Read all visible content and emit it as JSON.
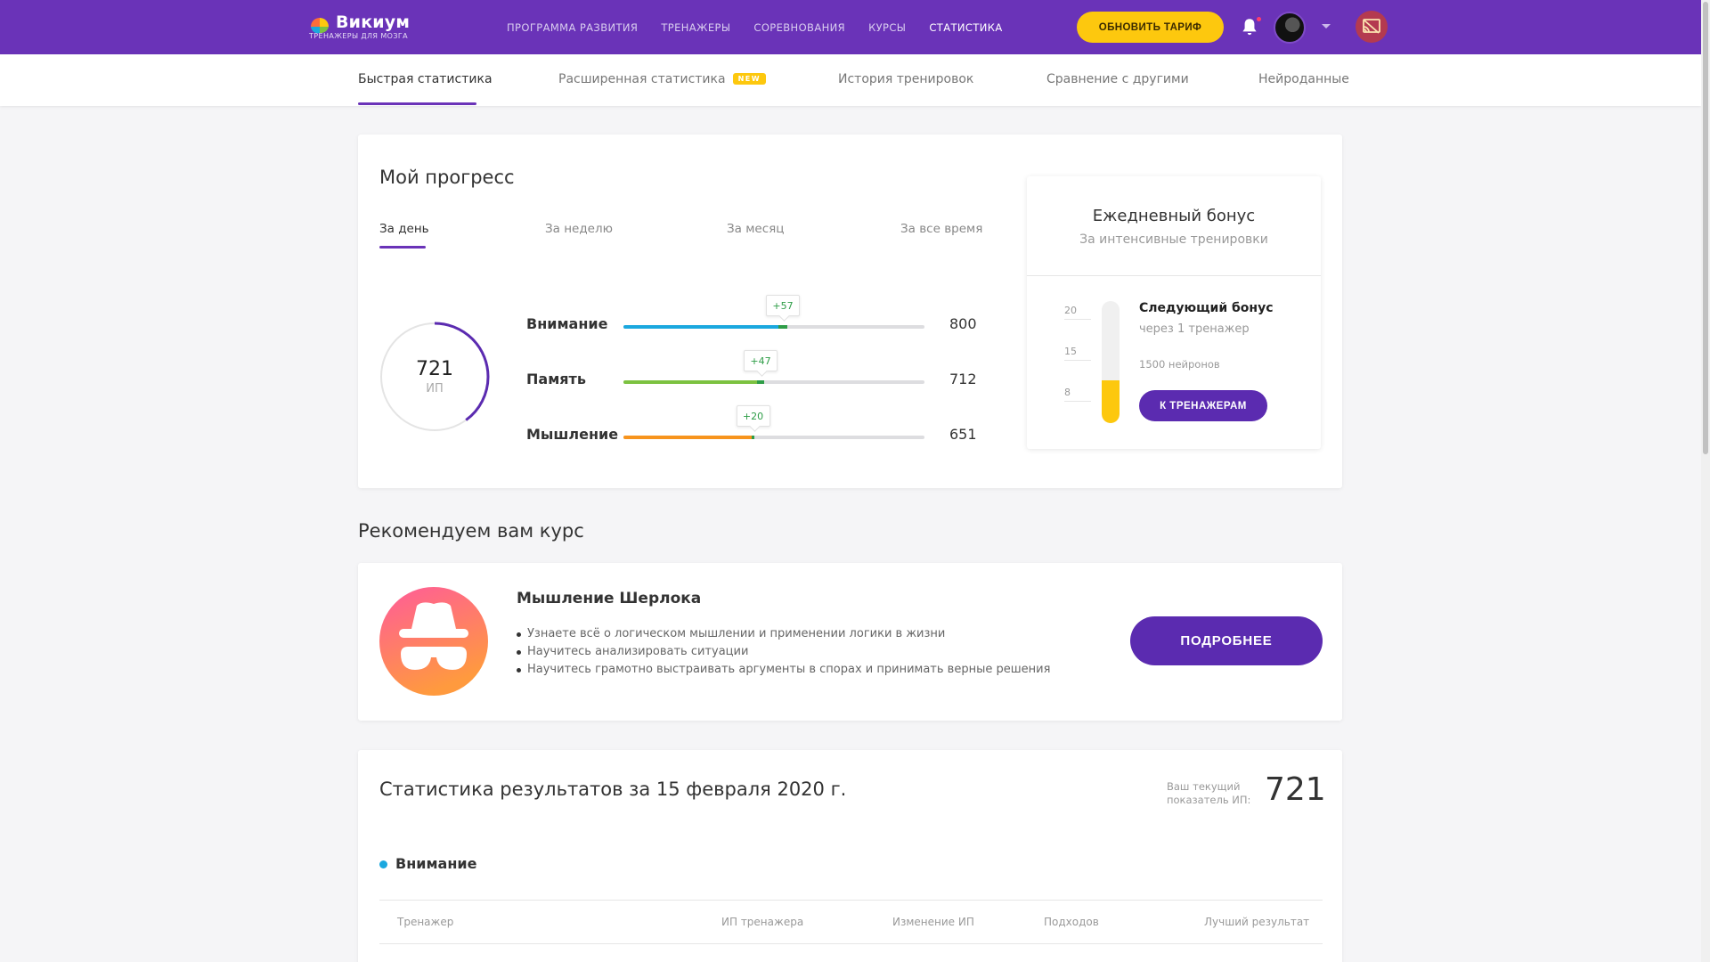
{
  "header": {
    "logo_name": "Викиум",
    "logo_sub": "ТРЕНАЖЕРЫ ДЛЯ МОЗГА",
    "nav": [
      "ПРОГРАММА РАЗВИТИЯ",
      "ТРЕНАЖЕРЫ",
      "СОРЕВНОВАНИЯ",
      "КУРСЫ",
      "СТАТИСТИКА"
    ],
    "active_nav": "СТАТИСТИКА",
    "upgrade_label": "ОБНОВИТЬ ТАРИФ"
  },
  "subtabs": [
    {
      "label": "Быстрая статистика",
      "active": true
    },
    {
      "label": "Расширенная статистика",
      "badge": "NEW"
    },
    {
      "label": "История тренировок"
    },
    {
      "label": "Сравнение с другими"
    },
    {
      "label": "Нейроданные"
    }
  ],
  "progress": {
    "title": "Мой прогресс",
    "periods": [
      "За день",
      "За неделю",
      "За месяц",
      "За все время"
    ],
    "active_period": "За день",
    "total_value": "721",
    "total_unit": "ИП",
    "ring_fraction": 0.4,
    "metrics": [
      {
        "label": "Внимание",
        "value": "800",
        "gain": "+57",
        "color": "#1ba8df",
        "fraction": 0.515,
        "gain_fraction": 0.03
      },
      {
        "label": "Память",
        "value": "712",
        "gain": "+47",
        "color": "#7cc240",
        "fraction": 0.445,
        "gain_fraction": 0.025
      },
      {
        "label": "Мышление",
        "value": "651",
        "gain": "+20",
        "color": "#f7941d",
        "fraction": 0.425,
        "gain_fraction": 0.008
      }
    ]
  },
  "bonus": {
    "title": "Ежедневный бонус",
    "subtitle": "За интенсивные тренировки",
    "ticks": [
      "20",
      "15",
      "8"
    ],
    "fill_fraction": 0.35,
    "next_title": "Следующий бонус",
    "next_sub": "через 1 тренажер",
    "neurons": "1500 нейронов",
    "button": "К ТРЕНАЖЕРАМ"
  },
  "recommend": {
    "section_title": "Рекомендуем вам курс",
    "course_title": "Мышление Шерлока",
    "bullets": [
      "Узнаете всё о логическом мышлении и применении логики в жизни",
      "Научитесь анализировать ситуации",
      "Научитесь грамотно выстраивать аргументы в спорах и принимать верные решения"
    ],
    "button": "ПОДРОБНЕЕ",
    "icon": "detective-icon"
  },
  "stats": {
    "title": "Статистика результатов за 15 февраля 2020 г.",
    "current_label": "Ваш текущий показатель ИП:",
    "current_value": "721",
    "category": "Внимание",
    "category_color": "#1ba8df",
    "columns": [
      "Тренажер",
      "ИП тренажера",
      "Изменение ИП",
      "Подходов",
      "Лучший результат"
    ]
  },
  "colors": {
    "brand": "#6a33b8",
    "accent": "#fdc80e",
    "button": "#5b2bb0"
  }
}
